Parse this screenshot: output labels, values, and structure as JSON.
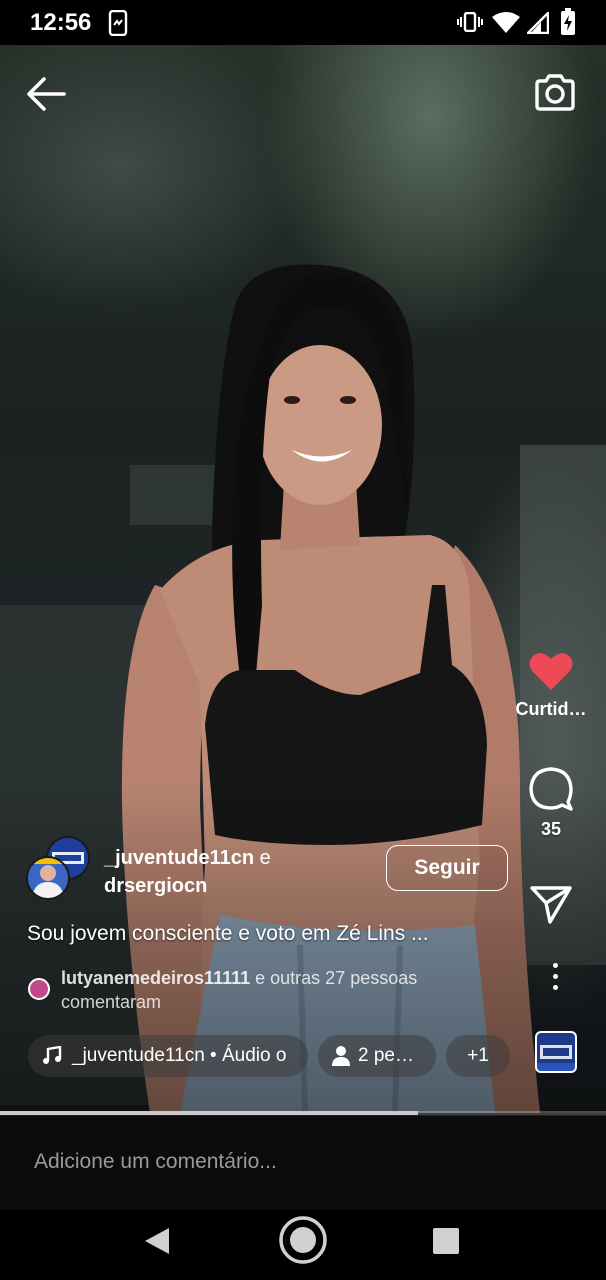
{
  "status_bar": {
    "time": "12:56",
    "icons": [
      "phone-sync-icon",
      "vibrate-icon",
      "wifi-icon",
      "signal-icon",
      "battery-charging-icon"
    ]
  },
  "top_bar": {
    "back_icon": "arrow-left-icon",
    "camera_icon": "camera-icon"
  },
  "video": {
    "progress_fraction": 0.69
  },
  "side_actions": {
    "like_label": "Curtid…",
    "like_color": "#ED4956",
    "comment_count": "35",
    "share_icon": "send-icon"
  },
  "post": {
    "owner_primary": "_juventude11cn",
    "conjunction": "e",
    "owner_secondary": "drsergiocn",
    "follow_label": "Seguir",
    "caption": "Sou jovem consciente e voto em Zé Lins ...",
    "commenters_bold": "lutyanemedeiros11111",
    "commenters_rest": " e outras 27 pessoas",
    "commenters_line2": "comentaram"
  },
  "chips": {
    "audio": "_juventude11cn • Áudio o",
    "people": "2 pe…",
    "more": "+1"
  },
  "comment_bar": {
    "placeholder": "Adicione um comentário..."
  },
  "nav": {
    "icons": [
      "back-triangle-icon",
      "home-circle-icon",
      "recents-square-icon"
    ]
  }
}
